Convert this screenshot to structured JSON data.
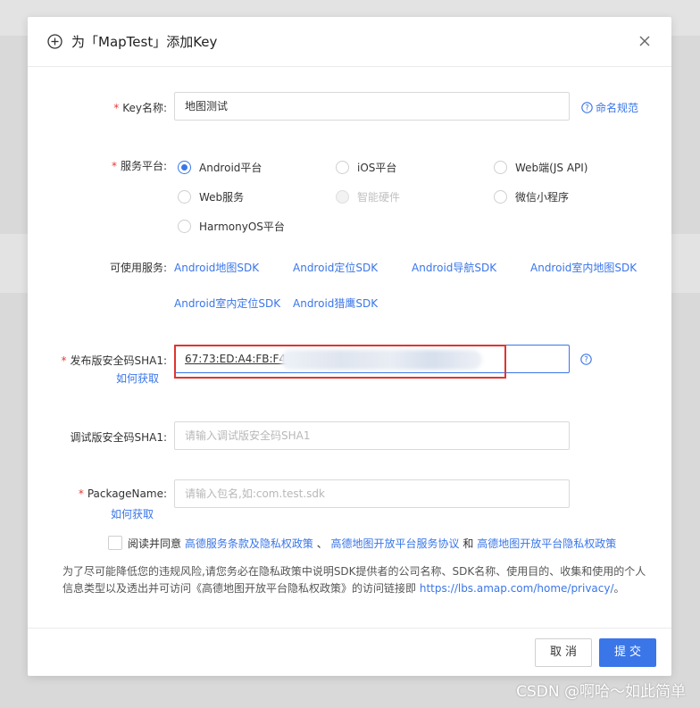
{
  "dialog": {
    "title": "为「MapTest」添加Key"
  },
  "form": {
    "key_name": {
      "label": "Key名称:",
      "value": "地图测试",
      "help_link": "命名规范"
    },
    "platform": {
      "label": "服务平台:",
      "options": [
        {
          "label": "Android平台",
          "selected": true,
          "disabled": false
        },
        {
          "label": "iOS平台",
          "selected": false,
          "disabled": false
        },
        {
          "label": "Web端(JS API)",
          "selected": false,
          "disabled": false
        },
        {
          "label": "Web服务",
          "selected": false,
          "disabled": false
        },
        {
          "label": "智能硬件",
          "selected": false,
          "disabled": true
        },
        {
          "label": "微信小程序",
          "selected": false,
          "disabled": false
        },
        {
          "label": "HarmonyOS平台",
          "selected": false,
          "disabled": false
        }
      ]
    },
    "services": {
      "label": "可使用服务:",
      "items": [
        "Android地图SDK",
        "Android定位SDK",
        "Android导航SDK",
        "Android室内地图SDK",
        "Android室内定位SDK",
        "Android猎鹰SDK"
      ]
    },
    "release_sha1": {
      "label": "发布版安全码SHA1:",
      "value": "67:73:ED:A4:FB:F4:2C",
      "how_to": "如何获取"
    },
    "debug_sha1": {
      "label": "调试版安全码SHA1:",
      "placeholder": "请输入调试版安全码SHA1"
    },
    "package_name": {
      "label": "PackageName:",
      "placeholder": "请输入包名,如:com.test.sdk",
      "how_to": "如何获取"
    }
  },
  "agreement": {
    "prefix": "阅读并同意",
    "link1": "高德服务条款及隐私权政策",
    "sep1": "、",
    "link2": "高德地图开放平台服务协议",
    "sep2": "和",
    "link3": "高德地图开放平台隐私权政策"
  },
  "notice": {
    "text": "为了尽可能降低您的违规风险,请您务必在隐私政策中说明SDK提供者的公司名称、SDK名称、使用目的、收集和使用的个人信息类型以及透出并可访问《高德地图开放平台隐私权政策》的访问链接即",
    "url": "https://lbs.amap.com/home/privacy/",
    "end": "。"
  },
  "footer": {
    "cancel": "取消",
    "submit": "提交"
  },
  "watermark": "CSDN @啊哈～如此简单",
  "colors": {
    "accent": "#3a76e8",
    "required": "#e53935",
    "highlight_box": "#e0352f"
  }
}
